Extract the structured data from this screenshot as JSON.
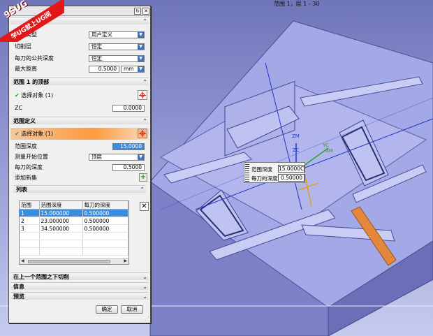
{
  "viewport": {
    "title": "范围 1，层 1 - 30",
    "axes": {
      "zm": "ZM",
      "zc": "ZC",
      "yc": "YC",
      "xm": "XM"
    },
    "popup": {
      "depth_label": "范围深度",
      "depth_value": "15.0000C",
      "per_cut_label": "每刀的深度",
      "per_cut_value": "0.50000"
    }
  },
  "watermark": {
    "logo": "9SUG",
    "band": "学UG就上UG网"
  },
  "dialog": {
    "title_buttons": [
      "↻",
      "✕"
    ],
    "global": {
      "type_label": "范围类型",
      "type_value": "用户定义",
      "cut_layer_label": "切削层",
      "cut_layer_value": "恒定",
      "common_depth_label": "每刀的公共深度",
      "common_depth_value": "恒定",
      "max_dist_label": "最大距离",
      "max_dist_value": "0.5000",
      "max_dist_unit": "mm"
    },
    "top_section": {
      "title": "范围 1 的顶部",
      "select_label": "选择对象 (1)",
      "zc_label": "ZC",
      "zc_value": "0.0000"
    },
    "range_def": {
      "title": "范围定义",
      "select_label": "选择对象 (1)",
      "depth_label": "范围深度",
      "depth_value": "15.0000",
      "measure_label": "测量开始位置",
      "measure_value": "顶层",
      "per_cut_label": "每刀的深度",
      "per_cut_value": "0.5000",
      "add_label": "添加新集"
    },
    "list": {
      "title": "列表",
      "columns": [
        "范围",
        "范围深度",
        "每刀的深度"
      ],
      "rows": [
        [
          "1",
          "15.000000",
          "0.500000"
        ],
        [
          "2",
          "23.000000",
          "0.500000"
        ],
        [
          "3",
          "34.500000",
          "0.500000"
        ]
      ]
    },
    "collapsed": [
      "在上一个范围之下切削",
      "信息",
      "预览"
    ],
    "ok": "确定",
    "cancel": "取消"
  },
  "colors": {
    "accent": "#3b8de0",
    "highlight": "#ff9a3c",
    "model": "#9ea3e6"
  }
}
